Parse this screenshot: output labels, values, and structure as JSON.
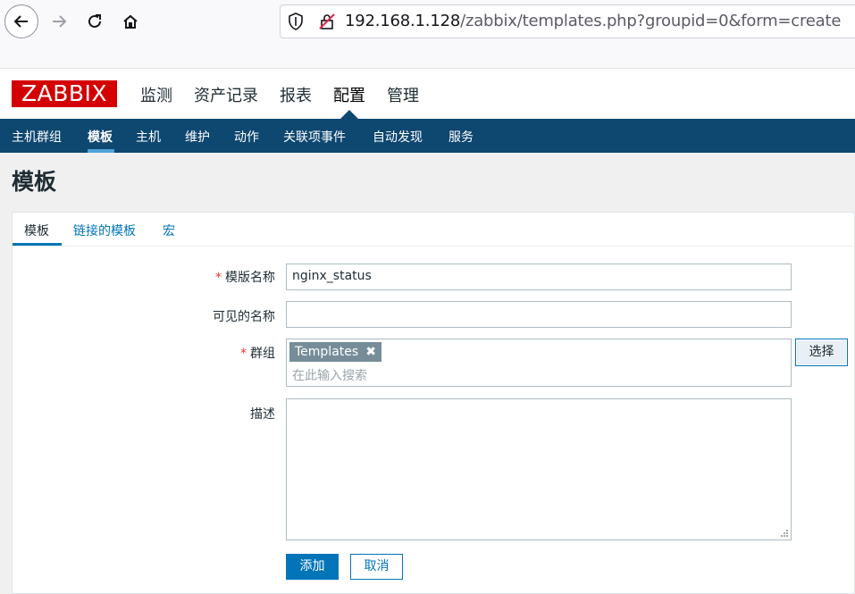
{
  "browser": {
    "url_host": "192.168.1.128",
    "url_path": "/zabbix/templates.php?groupid=0&form=create",
    "icons": [
      "back-icon",
      "forward-icon",
      "reload-icon",
      "home-icon",
      "shield-icon",
      "insecure-lock-icon"
    ]
  },
  "header": {
    "logo": "ZABBIX",
    "menu": [
      {
        "label": "监测"
      },
      {
        "label": "资产记录"
      },
      {
        "label": "报表"
      },
      {
        "label": "配置",
        "active": true
      },
      {
        "label": "管理"
      }
    ]
  },
  "submenu": {
    "items": [
      {
        "label": "主机群组"
      },
      {
        "label": "模板",
        "active": true
      },
      {
        "label": "主机"
      },
      {
        "label": "维护"
      },
      {
        "label": "动作"
      },
      {
        "label": "关联项事件"
      },
      {
        "label": "自动发现"
      },
      {
        "label": "服务"
      }
    ]
  },
  "page": {
    "title": "模板"
  },
  "tabs": [
    {
      "label": "模板",
      "active": true
    },
    {
      "label": "链接的模板"
    },
    {
      "label": "宏"
    }
  ],
  "form": {
    "required_mark": "*",
    "template_name_label": "模版名称",
    "template_name_value": "nginx_status",
    "visible_name_label": "可见的名称",
    "visible_name_value": "",
    "groups_label": "群组",
    "groups_selected": [
      "Templates"
    ],
    "groups_remove_glyph": "✖",
    "groups_placeholder": "在此输入搜索",
    "select_button": "选择",
    "description_label": "描述",
    "description_value": "",
    "add_button": "添加",
    "cancel_button": "取消"
  },
  "colors": {
    "brand_red": "#d40000",
    "nav_blue": "#0e4770",
    "link_blue": "#0275b8",
    "chip_gray": "#768d99",
    "required_red": "#e33734"
  }
}
